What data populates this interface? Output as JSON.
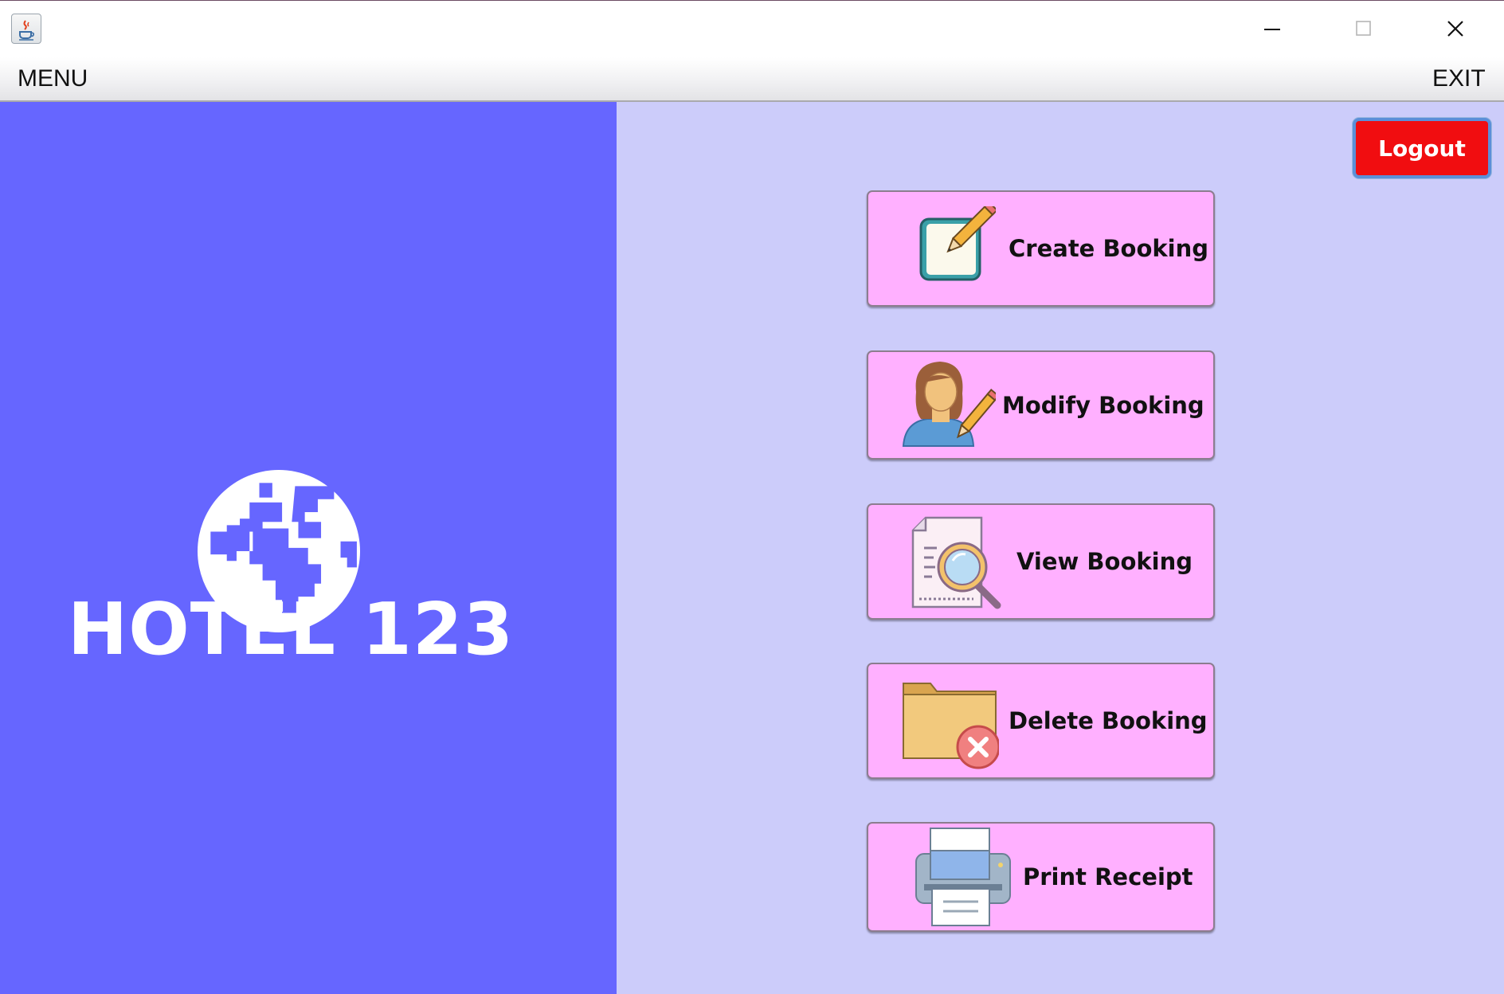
{
  "window": {
    "minimize_icon": "minimize-icon",
    "maximize_icon": "maximize-icon",
    "close_icon": "close-icon",
    "app_icon": "java-cup-icon"
  },
  "menubar": {
    "menu_label": "MENU",
    "exit_label": "EXIT"
  },
  "branding": {
    "icon": "globe-icon",
    "hotel_name": "HOTEL 123"
  },
  "header": {
    "logout_label": "Logout"
  },
  "actions": [
    {
      "label": "Create Booking",
      "icon": "notepad-pencil-icon"
    },
    {
      "label": "Modify Booking",
      "icon": "user-edit-icon"
    },
    {
      "label": "View Booking",
      "icon": "document-search-icon"
    },
    {
      "label": "Delete Booking",
      "icon": "folder-delete-icon"
    },
    {
      "label": "Print Receipt",
      "icon": "printer-icon"
    }
  ],
  "colors": {
    "left_panel": "#6666ff",
    "right_panel": "#ccccfa",
    "button_fill": "#ffb0ff",
    "logout_fill": "#f10d10"
  }
}
